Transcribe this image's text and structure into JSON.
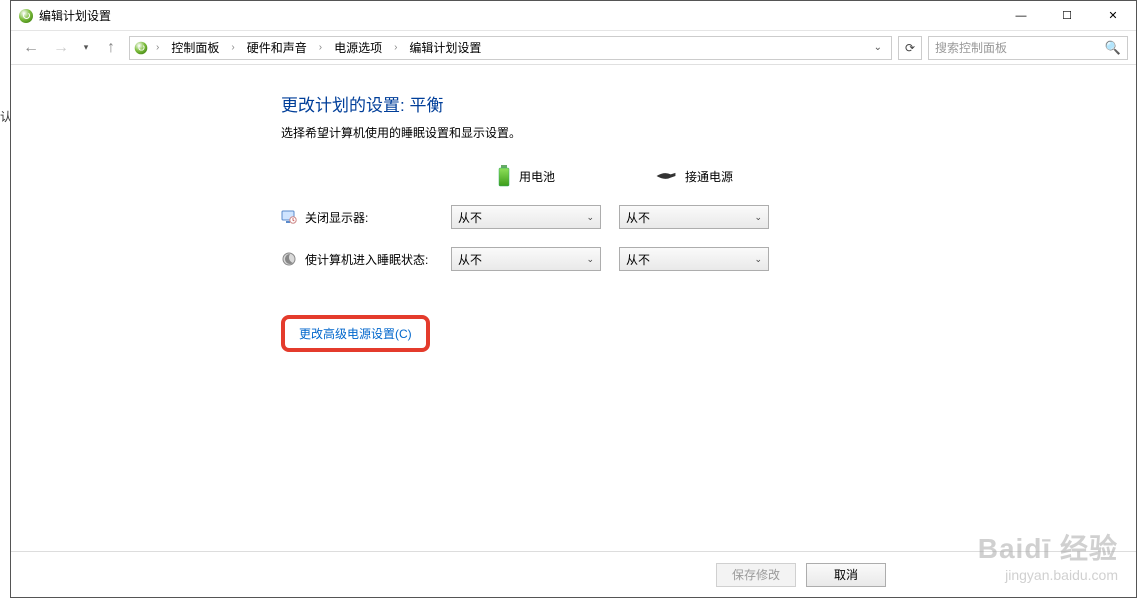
{
  "window": {
    "title": "编辑计划设置"
  },
  "titlebar_controls": {
    "min": "—",
    "max": "☐",
    "close": "✕"
  },
  "breadcrumb": {
    "items": [
      "控制面板",
      "硬件和声音",
      "电源选项",
      "编辑计划设置"
    ]
  },
  "search": {
    "placeholder": "搜索控制面板"
  },
  "page": {
    "title": "更改计划的设置: 平衡",
    "subtitle": "选择希望计算机使用的睡眠设置和显示设置。"
  },
  "columns": {
    "battery": "用电池",
    "plugged": "接通电源"
  },
  "rows": {
    "display_off": {
      "label": "关闭显示器:",
      "battery_value": "从不",
      "plugged_value": "从不"
    },
    "sleep": {
      "label": "使计算机进入睡眠状态:",
      "battery_value": "从不",
      "plugged_value": "从不"
    }
  },
  "links": {
    "advanced": "更改高级电源设置(C)"
  },
  "buttons": {
    "save": "保存修改",
    "cancel": "取消"
  },
  "watermark": {
    "main": "Baidī 经验",
    "sub": "jingyan.baidu.com"
  },
  "left_stub": "认"
}
